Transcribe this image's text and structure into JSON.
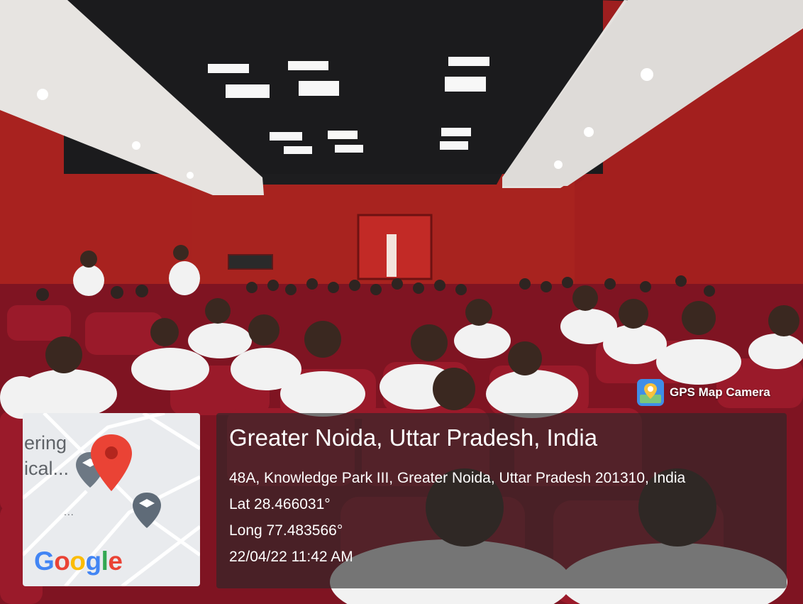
{
  "badge": {
    "label": "GPS Map Camera",
    "icon": "gps-map-camera-app-icon"
  },
  "map": {
    "labels": [
      "ering",
      "ical..."
    ],
    "dots": "...",
    "logo": {
      "letters": [
        "G",
        "o",
        "o",
        "g",
        "l",
        "e"
      ],
      "colors": [
        "#4285f4",
        "#ea4335",
        "#fbbc05",
        "#4285f4",
        "#34a853",
        "#ea4335"
      ]
    },
    "pin_color": "#ea4335",
    "marker_icon": "graduation-cap-icon"
  },
  "location": {
    "title": "Greater Noida, Uttar Pradesh, India",
    "address": "48A, Knowledge Park III, Greater Noida, Uttar Pradesh 201310, India",
    "lat": "Lat 28.466031°",
    "long": "Long 77.483566°",
    "datetime": "22/04/22 11:42 AM"
  },
  "colors": {
    "wall": "#a3201f",
    "seat": "#8b1624",
    "ceiling": "#1c1c1e",
    "panel_bg": "rgba(40,40,40,0.62)"
  }
}
